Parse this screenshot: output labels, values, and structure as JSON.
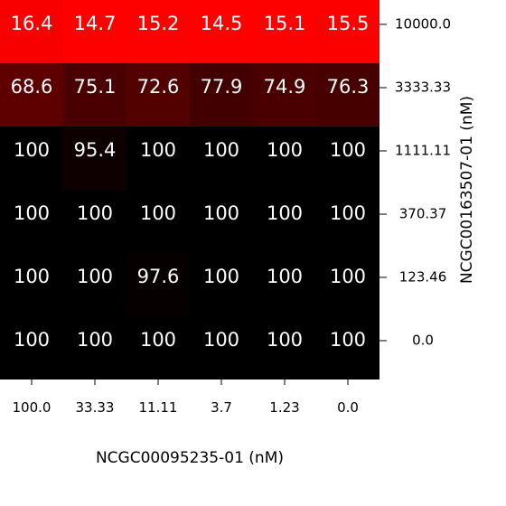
{
  "chart_data": {
    "type": "heatmap",
    "x_tick_labels": [
      "100.0",
      "33.33",
      "11.11",
      "3.7",
      "1.23",
      "0.0"
    ],
    "y_tick_labels": [
      "10000.0",
      "3333.33",
      "1111.11",
      "370.37",
      "123.46",
      "0.0"
    ],
    "xlabel": "NCGC00095235-01 (nM)",
    "ylabel": "NCGC00163507-01 (nM)",
    "values": [
      [
        16.4,
        14.7,
        15.2,
        14.5,
        15.1,
        15.5
      ],
      [
        68.6,
        75.1,
        72.6,
        77.9,
        74.9,
        76.3
      ],
      [
        100,
        95.4,
        100,
        100,
        100,
        100
      ],
      [
        100,
        100,
        100,
        100,
        100,
        100
      ],
      [
        100,
        100,
        97.6,
        100,
        100,
        100
      ],
      [
        100,
        100,
        100,
        100,
        100,
        100
      ]
    ],
    "color_low": "#ff0000",
    "color_high": "#000000",
    "label_color": "#ffffff"
  }
}
